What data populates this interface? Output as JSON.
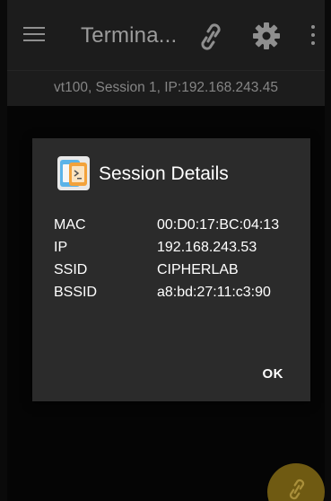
{
  "appbar": {
    "title": "Termina...",
    "icons": [
      "menu-icon",
      "link-icon",
      "gear-icon",
      "more-vert-icon"
    ]
  },
  "session_bar": {
    "text": "vt100, Session 1, IP:192.168.243.45"
  },
  "dialog": {
    "title": "Session Details",
    "icon": "terminal-app-icon",
    "details": [
      {
        "key": "MAC",
        "value": "00:D0:17:BC:04:13"
      },
      {
        "key": "IP",
        "value": "192.168.243.53"
      },
      {
        "key": "SSID",
        "value": "CIPHERLAB"
      },
      {
        "key": "BSSID",
        "value": "a8:bd:27:11:c3:90"
      }
    ],
    "ok_label": "OK"
  },
  "fab": {
    "icon": "link-icon",
    "color": "#6f5a12"
  },
  "colors": {
    "appbar": "#1c1c1c",
    "dialog": "#2b2b2b",
    "accent": "#c9a227"
  }
}
